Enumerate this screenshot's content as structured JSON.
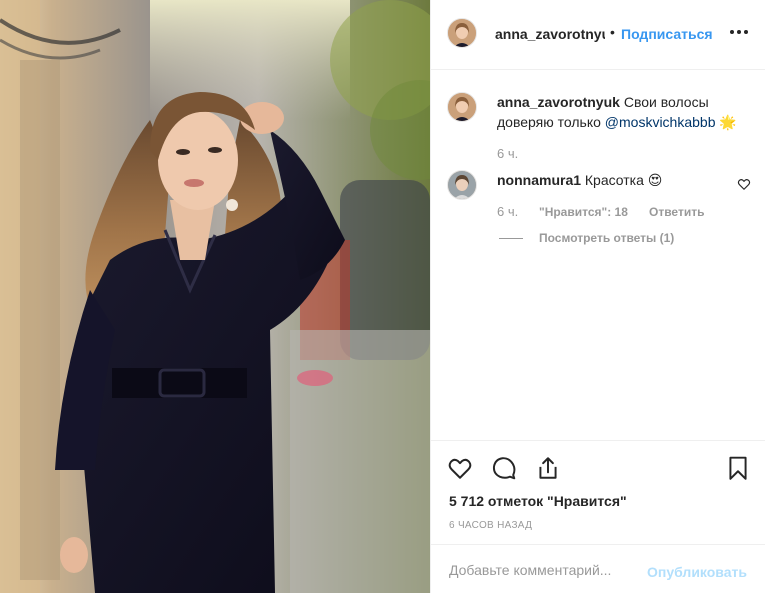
{
  "header": {
    "username": "anna_zavorotnyuk",
    "separator": "•",
    "follow_label": "Подписаться"
  },
  "caption": {
    "username": "anna_zavorotnyuk",
    "text": "Свои волосы доверяю только",
    "mention": "@moskvichkabbb",
    "emoji": "🌟",
    "time": "6 ч."
  },
  "comment": {
    "username": "nonnamura1",
    "text": "Красотка",
    "emoji": "😍",
    "time": "6 ч.",
    "likes_label": "\"Нравится\": 18",
    "reply_label": "Ответить",
    "view_replies_label": "Посмотреть ответы (1)"
  },
  "likes_label": "5 712 отметок \"Нравится\"",
  "date_label": "6 ЧАСОВ НАЗАД",
  "add_comment": {
    "placeholder": "Добавьте комментарий...",
    "publish_label": "Опубликовать"
  },
  "colors": {
    "link_blue": "#3897f0",
    "mention_blue": "#003569",
    "muted": "#999999",
    "publish_disabled": "#b2dffc"
  },
  "icons": [
    "more-options-icon",
    "heart-icon",
    "comment-icon",
    "share-icon",
    "bookmark-icon",
    "comment-like-icon"
  ]
}
